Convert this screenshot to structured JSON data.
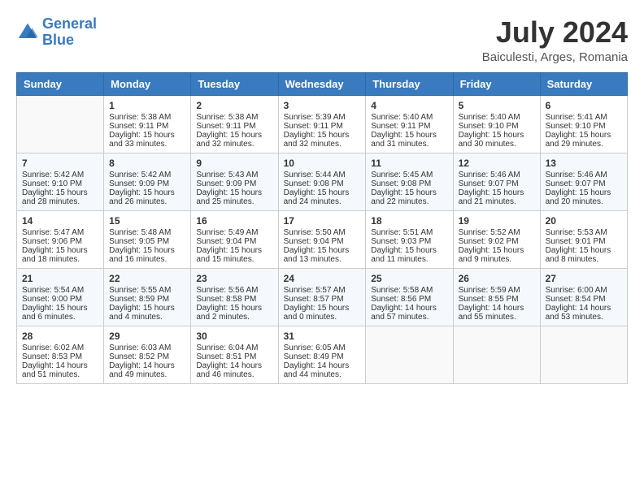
{
  "header": {
    "logo_line1": "General",
    "logo_line2": "Blue",
    "month_year": "July 2024",
    "location": "Baiculesti, Arges, Romania"
  },
  "weekdays": [
    "Sunday",
    "Monday",
    "Tuesday",
    "Wednesday",
    "Thursday",
    "Friday",
    "Saturday"
  ],
  "weeks": [
    [
      {
        "day": "",
        "sunrise": "",
        "sunset": "",
        "daylight": ""
      },
      {
        "day": "1",
        "sunrise": "Sunrise: 5:38 AM",
        "sunset": "Sunset: 9:11 PM",
        "daylight": "Daylight: 15 hours and 33 minutes."
      },
      {
        "day": "2",
        "sunrise": "Sunrise: 5:38 AM",
        "sunset": "Sunset: 9:11 PM",
        "daylight": "Daylight: 15 hours and 32 minutes."
      },
      {
        "day": "3",
        "sunrise": "Sunrise: 5:39 AM",
        "sunset": "Sunset: 9:11 PM",
        "daylight": "Daylight: 15 hours and 32 minutes."
      },
      {
        "day": "4",
        "sunrise": "Sunrise: 5:40 AM",
        "sunset": "Sunset: 9:11 PM",
        "daylight": "Daylight: 15 hours and 31 minutes."
      },
      {
        "day": "5",
        "sunrise": "Sunrise: 5:40 AM",
        "sunset": "Sunset: 9:10 PM",
        "daylight": "Daylight: 15 hours and 30 minutes."
      },
      {
        "day": "6",
        "sunrise": "Sunrise: 5:41 AM",
        "sunset": "Sunset: 9:10 PM",
        "daylight": "Daylight: 15 hours and 29 minutes."
      }
    ],
    [
      {
        "day": "7",
        "sunrise": "Sunrise: 5:42 AM",
        "sunset": "Sunset: 9:10 PM",
        "daylight": "Daylight: 15 hours and 28 minutes."
      },
      {
        "day": "8",
        "sunrise": "Sunrise: 5:42 AM",
        "sunset": "Sunset: 9:09 PM",
        "daylight": "Daylight: 15 hours and 26 minutes."
      },
      {
        "day": "9",
        "sunrise": "Sunrise: 5:43 AM",
        "sunset": "Sunset: 9:09 PM",
        "daylight": "Daylight: 15 hours and 25 minutes."
      },
      {
        "day": "10",
        "sunrise": "Sunrise: 5:44 AM",
        "sunset": "Sunset: 9:08 PM",
        "daylight": "Daylight: 15 hours and 24 minutes."
      },
      {
        "day": "11",
        "sunrise": "Sunrise: 5:45 AM",
        "sunset": "Sunset: 9:08 PM",
        "daylight": "Daylight: 15 hours and 22 minutes."
      },
      {
        "day": "12",
        "sunrise": "Sunrise: 5:46 AM",
        "sunset": "Sunset: 9:07 PM",
        "daylight": "Daylight: 15 hours and 21 minutes."
      },
      {
        "day": "13",
        "sunrise": "Sunrise: 5:46 AM",
        "sunset": "Sunset: 9:07 PM",
        "daylight": "Daylight: 15 hours and 20 minutes."
      }
    ],
    [
      {
        "day": "14",
        "sunrise": "Sunrise: 5:47 AM",
        "sunset": "Sunset: 9:06 PM",
        "daylight": "Daylight: 15 hours and 18 minutes."
      },
      {
        "day": "15",
        "sunrise": "Sunrise: 5:48 AM",
        "sunset": "Sunset: 9:05 PM",
        "daylight": "Daylight: 15 hours and 16 minutes."
      },
      {
        "day": "16",
        "sunrise": "Sunrise: 5:49 AM",
        "sunset": "Sunset: 9:04 PM",
        "daylight": "Daylight: 15 hours and 15 minutes."
      },
      {
        "day": "17",
        "sunrise": "Sunrise: 5:50 AM",
        "sunset": "Sunset: 9:04 PM",
        "daylight": "Daylight: 15 hours and 13 minutes."
      },
      {
        "day": "18",
        "sunrise": "Sunrise: 5:51 AM",
        "sunset": "Sunset: 9:03 PM",
        "daylight": "Daylight: 15 hours and 11 minutes."
      },
      {
        "day": "19",
        "sunrise": "Sunrise: 5:52 AM",
        "sunset": "Sunset: 9:02 PM",
        "daylight": "Daylight: 15 hours and 9 minutes."
      },
      {
        "day": "20",
        "sunrise": "Sunrise: 5:53 AM",
        "sunset": "Sunset: 9:01 PM",
        "daylight": "Daylight: 15 hours and 8 minutes."
      }
    ],
    [
      {
        "day": "21",
        "sunrise": "Sunrise: 5:54 AM",
        "sunset": "Sunset: 9:00 PM",
        "daylight": "Daylight: 15 hours and 6 minutes."
      },
      {
        "day": "22",
        "sunrise": "Sunrise: 5:55 AM",
        "sunset": "Sunset: 8:59 PM",
        "daylight": "Daylight: 15 hours and 4 minutes."
      },
      {
        "day": "23",
        "sunrise": "Sunrise: 5:56 AM",
        "sunset": "Sunset: 8:58 PM",
        "daylight": "Daylight: 15 hours and 2 minutes."
      },
      {
        "day": "24",
        "sunrise": "Sunrise: 5:57 AM",
        "sunset": "Sunset: 8:57 PM",
        "daylight": "Daylight: 15 hours and 0 minutes."
      },
      {
        "day": "25",
        "sunrise": "Sunrise: 5:58 AM",
        "sunset": "Sunset: 8:56 PM",
        "daylight": "Daylight: 14 hours and 57 minutes."
      },
      {
        "day": "26",
        "sunrise": "Sunrise: 5:59 AM",
        "sunset": "Sunset: 8:55 PM",
        "daylight": "Daylight: 14 hours and 55 minutes."
      },
      {
        "day": "27",
        "sunrise": "Sunrise: 6:00 AM",
        "sunset": "Sunset: 8:54 PM",
        "daylight": "Daylight: 14 hours and 53 minutes."
      }
    ],
    [
      {
        "day": "28",
        "sunrise": "Sunrise: 6:02 AM",
        "sunset": "Sunset: 8:53 PM",
        "daylight": "Daylight: 14 hours and 51 minutes."
      },
      {
        "day": "29",
        "sunrise": "Sunrise: 6:03 AM",
        "sunset": "Sunset: 8:52 PM",
        "daylight": "Daylight: 14 hours and 49 minutes."
      },
      {
        "day": "30",
        "sunrise": "Sunrise: 6:04 AM",
        "sunset": "Sunset: 8:51 PM",
        "daylight": "Daylight: 14 hours and 46 minutes."
      },
      {
        "day": "31",
        "sunrise": "Sunrise: 6:05 AM",
        "sunset": "Sunset: 8:49 PM",
        "daylight": "Daylight: 14 hours and 44 minutes."
      },
      {
        "day": "",
        "sunrise": "",
        "sunset": "",
        "daylight": ""
      },
      {
        "day": "",
        "sunrise": "",
        "sunset": "",
        "daylight": ""
      },
      {
        "day": "",
        "sunrise": "",
        "sunset": "",
        "daylight": ""
      }
    ]
  ]
}
